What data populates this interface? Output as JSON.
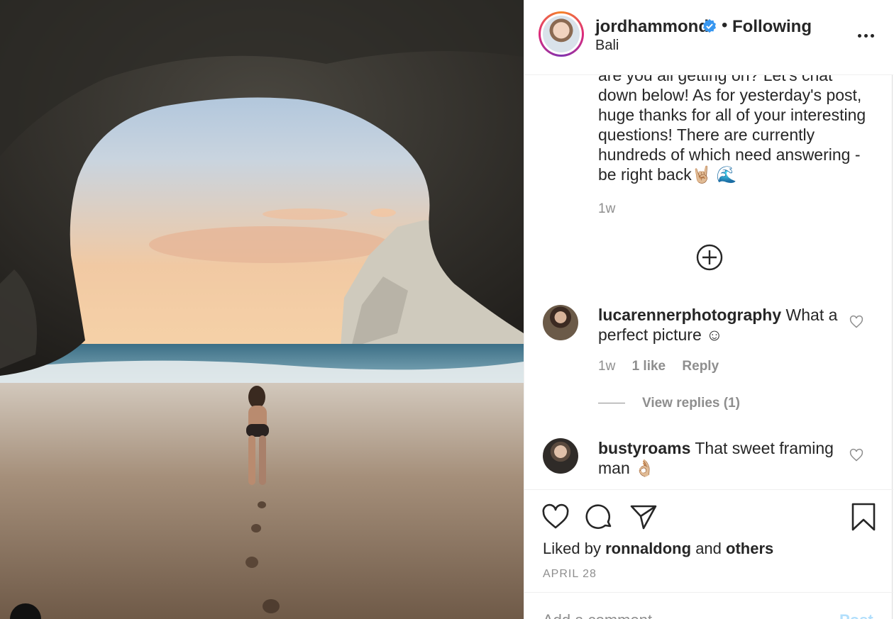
{
  "header": {
    "username": "jordhammond",
    "verified_icon": "verified-badge-icon",
    "separator": "•",
    "follow_status": "Following",
    "location": "Bali",
    "more_icon": "more-options-icon"
  },
  "caption": {
    "text": "are you all getting on? Let's chat down below! As for yesterday's post, huge thanks for all of your interesting questions! There are currently hundreds of which need answering - be right back🤘🏼 🌊",
    "time": "1w",
    "load_more_icon": "plus-circle-icon"
  },
  "comments": [
    {
      "username": "lucarennerphotography",
      "text": "What a perfect picture ☺",
      "time": "1w",
      "likes": "1 like",
      "reply": "Reply",
      "view_replies": "View replies (1)"
    },
    {
      "username": "bustyroams",
      "text": "That sweet framing man 👌🏼"
    }
  ],
  "actions": {
    "liked_prefix": "Liked by",
    "liked_user": "ronnaldong",
    "liked_and": "and",
    "liked_others": "others",
    "date": "APRIL 28"
  },
  "add_comment": {
    "placeholder": "Add a comment…",
    "post_label": "Post"
  },
  "colors": {
    "text": "#262626",
    "secondary": "#8e8e8e",
    "verified": "#3897f0",
    "post_disabled": "#b2dffc"
  }
}
